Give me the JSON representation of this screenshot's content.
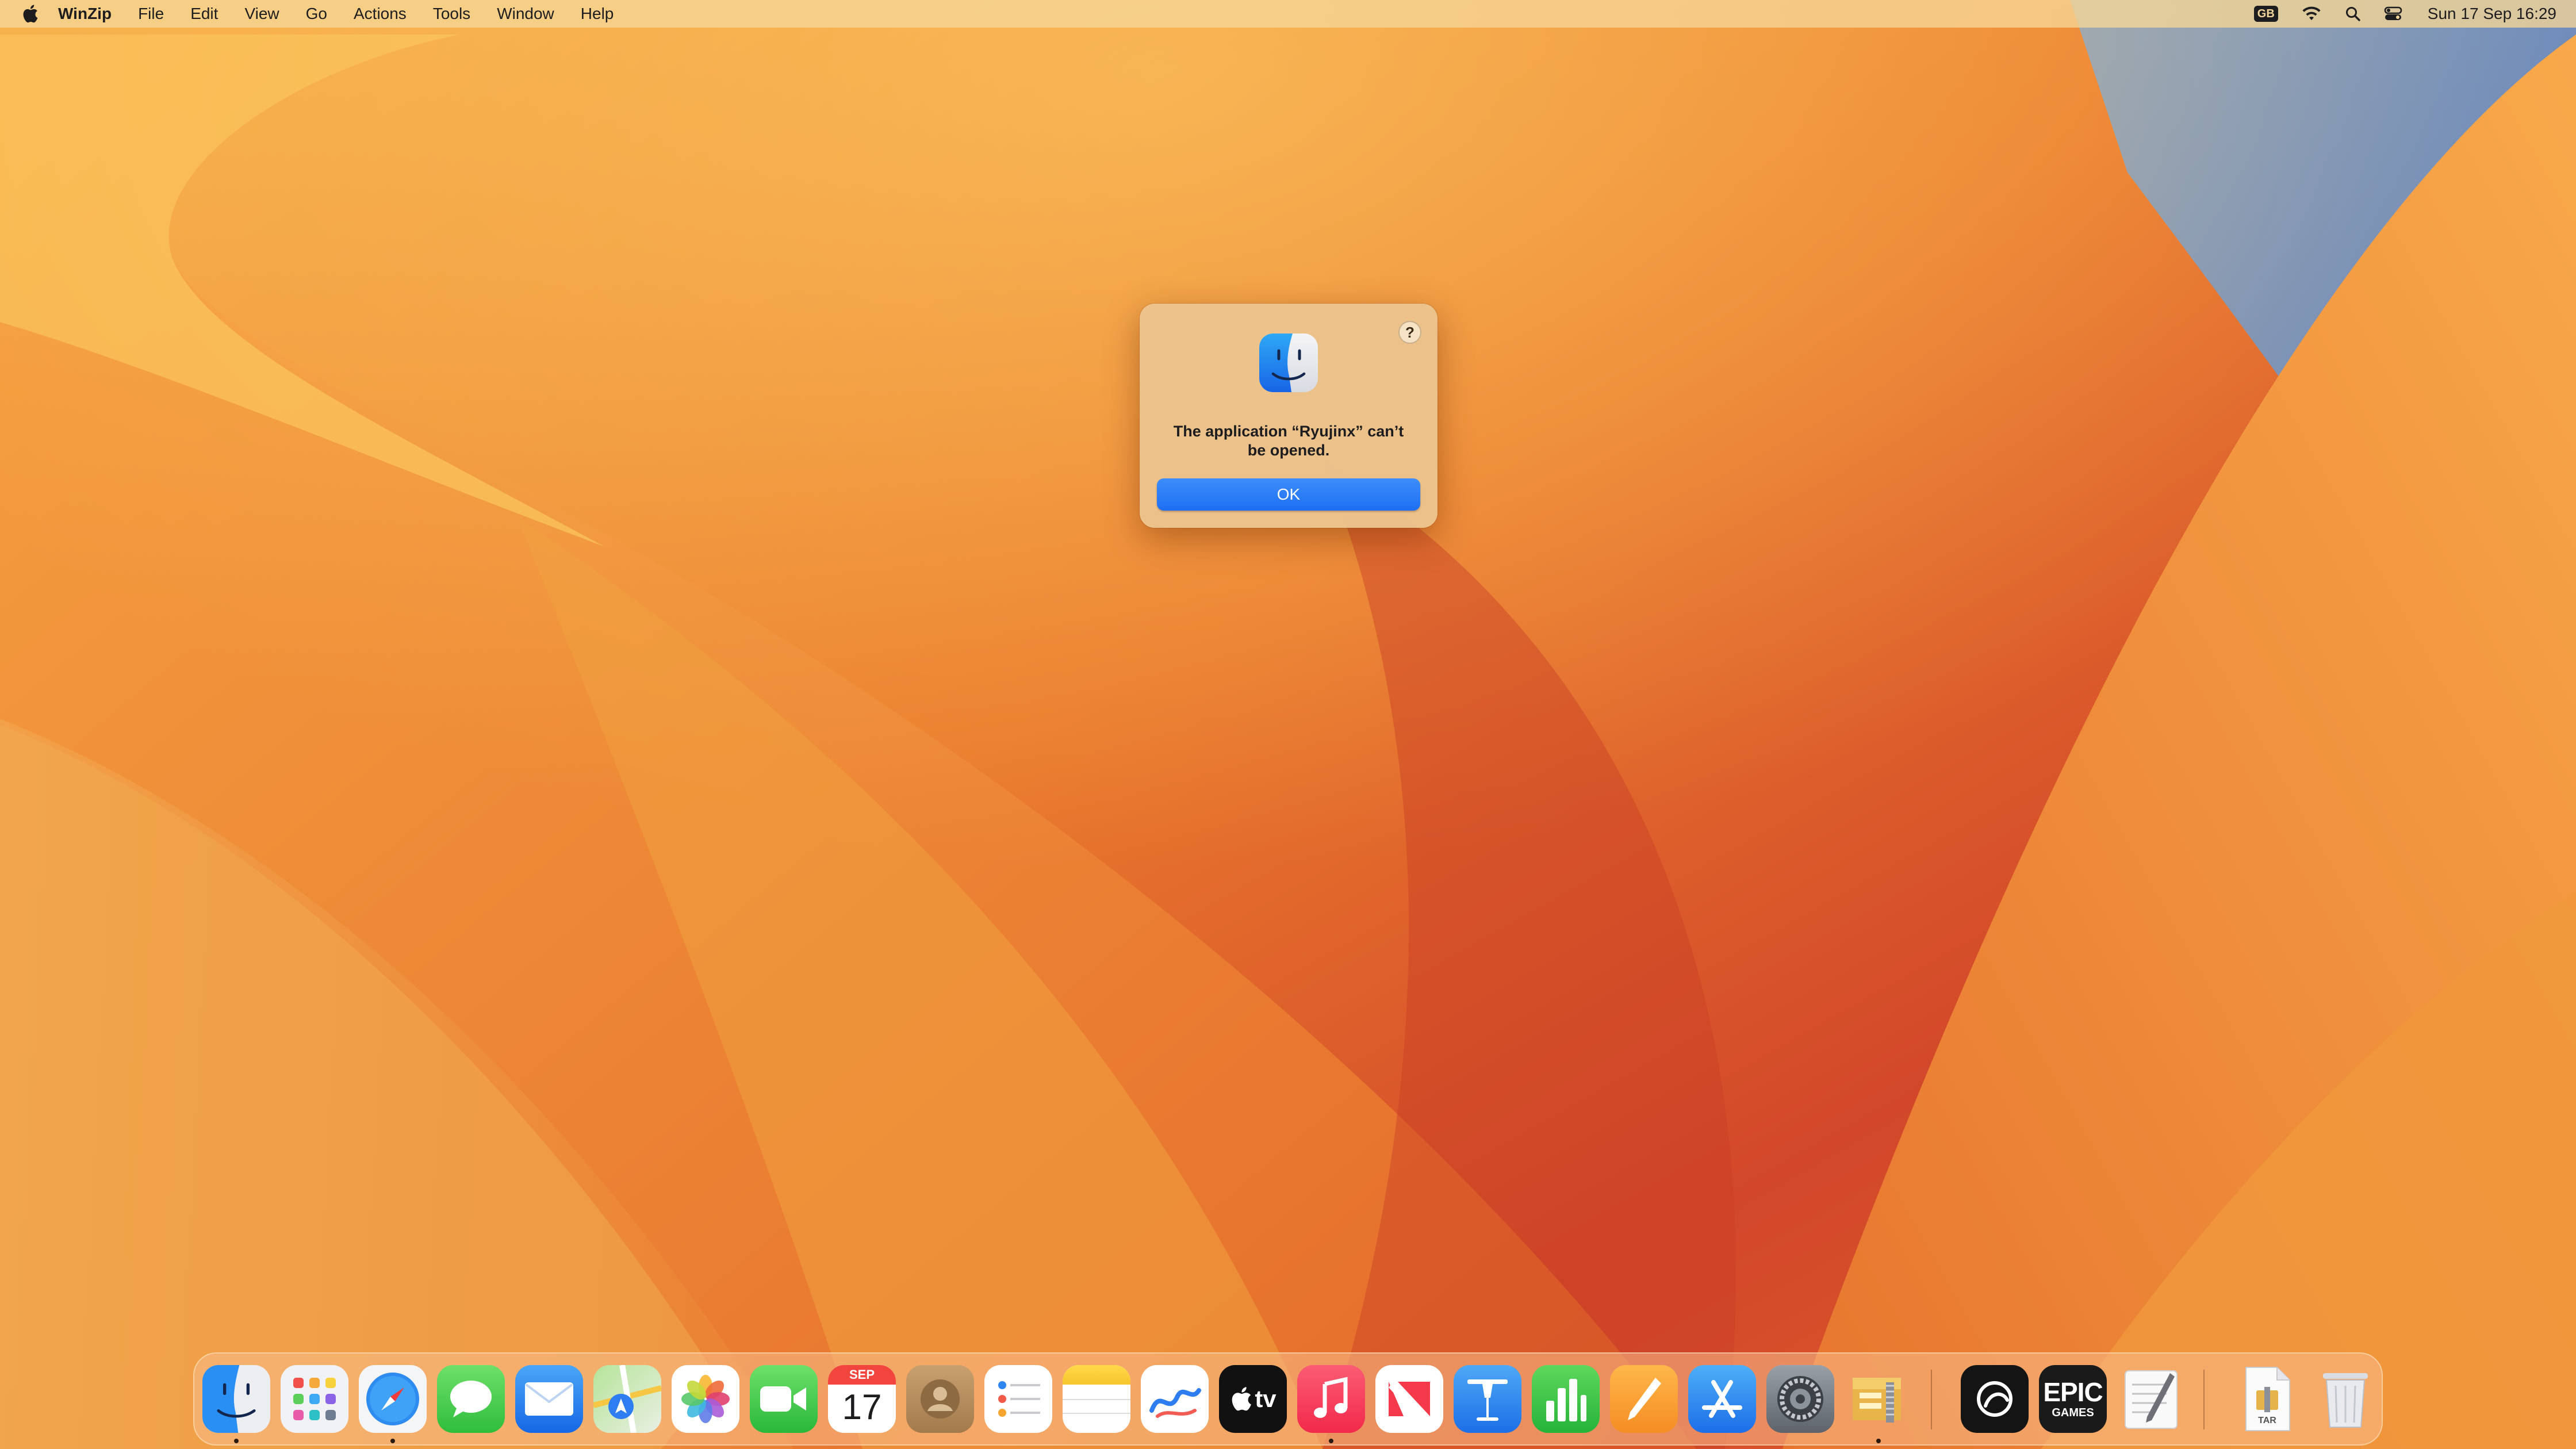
{
  "menubar": {
    "apple_icon": "apple-logo-icon",
    "app_name": "WinZip",
    "menus": [
      "File",
      "Edit",
      "View",
      "Go",
      "Actions",
      "Tools",
      "Window",
      "Help"
    ],
    "status": {
      "input_source": "GB",
      "wifi_icon": "wifi-icon",
      "search_icon": "search-icon",
      "control_center_icon": "control-center-icon",
      "clock": "Sun 17 Sep  16:29"
    }
  },
  "alert": {
    "icon": "finder-icon",
    "help_label": "?",
    "message": "The application “Ryujinx” can’t be opened.",
    "ok_label": "OK",
    "accent": "#2a7af5"
  },
  "dock": {
    "items": [
      {
        "name": "Finder",
        "icon": "finder-icon",
        "running": true
      },
      {
        "name": "Launchpad",
        "icon": "launchpad-icon",
        "running": false
      },
      {
        "name": "Safari",
        "icon": "safari-icon",
        "running": true
      },
      {
        "name": "Messages",
        "icon": "messages-icon",
        "running": false
      },
      {
        "name": "Mail",
        "icon": "mail-icon",
        "running": false
      },
      {
        "name": "Maps",
        "icon": "maps-icon",
        "running": false
      },
      {
        "name": "Photos",
        "icon": "photos-icon",
        "running": false
      },
      {
        "name": "FaceTime",
        "icon": "facetime-icon",
        "running": false
      },
      {
        "name": "Calendar",
        "icon": "calendar-icon",
        "running": false,
        "month": "SEP",
        "day": "17"
      },
      {
        "name": "Contacts",
        "icon": "contacts-icon",
        "running": false
      },
      {
        "name": "Reminders",
        "icon": "reminders-icon",
        "running": false
      },
      {
        "name": "Notes",
        "icon": "notes-icon",
        "running": false
      },
      {
        "name": "Freeform",
        "icon": "freeform-icon",
        "running": false
      },
      {
        "name": "TV",
        "icon": "apple-tv-icon",
        "running": false,
        "label": "tv"
      },
      {
        "name": "Music",
        "icon": "music-icon",
        "running": true
      },
      {
        "name": "News",
        "icon": "news-icon",
        "running": false
      },
      {
        "name": "Keynote",
        "icon": "keynote-icon",
        "running": false
      },
      {
        "name": "Numbers",
        "icon": "numbers-icon",
        "running": false
      },
      {
        "name": "Pages",
        "icon": "pages-icon",
        "running": false
      },
      {
        "name": "App Store",
        "icon": "app-store-icon",
        "running": false
      },
      {
        "name": "System Settings",
        "icon": "system-settings-icon",
        "running": false
      },
      {
        "name": "WinZip",
        "icon": "winzip-icon",
        "running": true
      },
      {
        "name": "ChatGPT",
        "icon": "chatgpt-icon",
        "running": false
      },
      {
        "name": "Epic Games Launcher",
        "icon": "epic-games-icon",
        "running": false,
        "label_top": "EPIC",
        "label_bottom": "GAMES"
      },
      {
        "name": "TextEdit",
        "icon": "textedit-icon",
        "running": false
      },
      {
        "name": "TAR archive",
        "icon": "tar-file-icon",
        "running": false,
        "label": "TAR"
      },
      {
        "name": "Trash",
        "icon": "trash-icon",
        "running": false
      }
    ]
  }
}
